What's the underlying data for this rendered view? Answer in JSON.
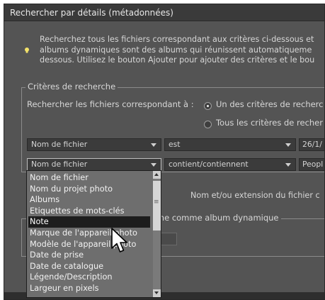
{
  "window": {
    "title": "Rechercher par détails (métadonnées)"
  },
  "info": {
    "icon": "lightbulb-icon",
    "lines": [
      "Recherchez tous les fichiers correspondant aux critères ci-dessous et",
      "albums dynamiques sont des albums qui réunissent automatiqueme",
      "dessous. Utilisez le bouton Ajouter pour ajouter des critères et le bou"
    ]
  },
  "criteria": {
    "legend": "Critères de recherche",
    "match_label": "Rechercher les fichiers correspondant à :",
    "radio_any": "Un des critères de recherc",
    "radio_all": "Tous les critères de recher",
    "radio_any_selected": true,
    "row1": {
      "field": "Nom de fichier",
      "operator": "est",
      "value": "26/1/"
    },
    "row2": {
      "field": "Nom de fichier",
      "operator": "contient/contiennent",
      "value": "Peopl"
    },
    "hint": "Nom et/ou extension du fichier c"
  },
  "album": {
    "legend_fragment": "rche comme album dynamique"
  },
  "dropdown": {
    "selected": "Note",
    "options": [
      "Nom de fichier",
      "Nom du projet photo",
      "Albums",
      "Etiquettes de mots-clés",
      "Note",
      "Marque de l'appareil photo",
      "Modèle de l'appareil photo",
      "Date de prise",
      "Date de catalogue",
      "Légende/Description",
      "Largeur en pixels"
    ]
  },
  "colors": {
    "background": "#545454",
    "titlebar": "#3a3a3a",
    "selection": "#1d1d1d",
    "dropdown": "#6e6e6e",
    "lightbulb": "#f4e36a"
  }
}
